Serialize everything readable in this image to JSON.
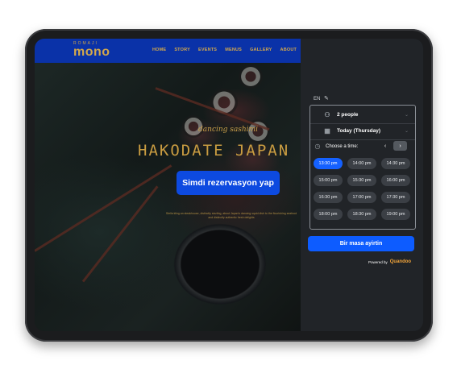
{
  "site": {
    "logo_top": "ROMAJI",
    "logo": "mono",
    "nav": [
      "HOME",
      "STORY",
      "EVENTS",
      "MENUS",
      "GALLERY",
      "ABOUT"
    ],
    "script_text": "dancing sashimi",
    "headline": "HAKODATE JAPAN SEAF",
    "cta": "Simdi rezervasyon yap",
    "small_text_1": "Stella kling an steakhouse, distinctly sizzling, about Japan's dancing squid dish to the flourishing seafood",
    "small_text_2": "and distinctly authentic fresh delights"
  },
  "booking": {
    "language": "EN",
    "guests": "2 people",
    "date": "Today (Thursday)",
    "choose_time": "Choose a time:",
    "slots": [
      "13:30 pm",
      "14:00 pm",
      "14:30 pm",
      "15:00 pm",
      "15:30 pm",
      "16:00 pm",
      "16:30 pm",
      "17:00 pm",
      "17:30 pm",
      "18:00 pm",
      "18:30 pm",
      "19:00 pm"
    ],
    "selected_slot": "13:30 pm",
    "book_button": "Bir masa ayirtin",
    "powered_by": "Powered by",
    "brand": "Quandoo",
    "colors": {
      "accent": "#0d5cff",
      "panel": "#212428",
      "nav": "#0a32a8",
      "gold": "#d3a84b"
    }
  }
}
